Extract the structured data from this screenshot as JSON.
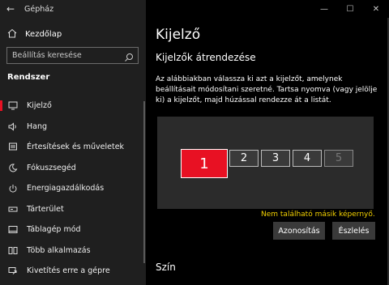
{
  "window": {
    "title": "Gépház",
    "back_glyph": "←",
    "controls": [
      "—",
      "☐",
      "✕"
    ]
  },
  "sidebar": {
    "home": {
      "label": "Kezdőlap",
      "icon": "home-icon"
    },
    "search": {
      "placeholder": "Beállítás keresése",
      "icon": "search-icon"
    },
    "section_label": "Rendszer",
    "items": [
      {
        "label": "Kijelző",
        "icon": "display-icon",
        "active": true
      },
      {
        "label": "Hang",
        "icon": "speaker-icon"
      },
      {
        "label": "Értesítések és műveletek",
        "icon": "notification-icon"
      },
      {
        "label": "Fókuszsegéd",
        "icon": "moon-icon"
      },
      {
        "label": "Energiagazdálkodás",
        "icon": "power-icon"
      },
      {
        "label": "Tárterület",
        "icon": "storage-icon"
      },
      {
        "label": "Táblagép mód",
        "icon": "tablet-icon"
      },
      {
        "label": "Több alkalmazás",
        "icon": "multitask-icon"
      },
      {
        "label": "Kivetítés erre a gépre",
        "icon": "project-icon"
      }
    ]
  },
  "main": {
    "title": "Kijelző",
    "subtitle": "Kijelzők átrendezése",
    "description": "Az alábbiakban válassza ki azt a kijelzőt, amelynek beállításait módosítani szeretné. Tartsa nyomva (vagy jelölje ki) a kijelzőt, majd húzással rendezze át a listát.",
    "monitors": [
      "1",
      "2",
      "3",
      "4",
      "5"
    ],
    "warning": "Nem található másik képernyő.",
    "identify_button": "Azonosítás",
    "detect_button": "Észlelés",
    "next_section": "Szín"
  },
  "colors": {
    "accent": "#e81123",
    "warning": "#f2d000",
    "sidebar_bg": "#1f1f1f",
    "main_bg": "#000000"
  }
}
